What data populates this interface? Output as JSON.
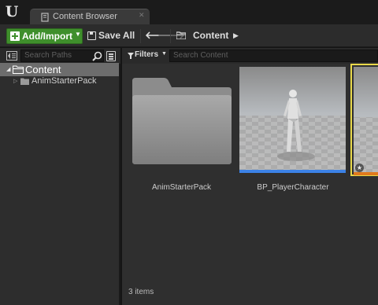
{
  "window": {
    "tab_title": "Content Browser",
    "logo_letter": "U"
  },
  "toolbar": {
    "add_import_label": "Add/Import",
    "save_all_label": "Save All",
    "breadcrumb": [
      "Content"
    ]
  },
  "sources_panel": {
    "search_placeholder": "Search Paths",
    "tree": [
      {
        "label": "Content",
        "expanded": true,
        "selected": true
      },
      {
        "label": "AnimStarterPack",
        "expanded": false,
        "selected": false
      }
    ]
  },
  "content_panel": {
    "filters_label": "Filters",
    "search_placeholder": "Search Content",
    "assets": [
      {
        "name": "AnimStarterPack",
        "type": "folder"
      },
      {
        "name": "BP_PlayerCharacter",
        "type": "blueprint",
        "accent": "#3c82e6"
      },
      {
        "name": "",
        "type": "asset",
        "selected": true,
        "accent": "#e07a1e"
      }
    ],
    "item_count": "3 items"
  },
  "colors": {
    "add_button": "#3f8f2c",
    "selection_outline": "#e8d84a",
    "blueprint_bar": "#3c82e6",
    "selected_asset_bar": "#e07a1e",
    "tree_selected": "#6d6d6d"
  },
  "icons": [
    "unreal-logo-icon",
    "content-browser-icon",
    "close-icon",
    "add-icon",
    "save-icon",
    "back-arrow-icon",
    "forward-arrow-icon",
    "folder-icon",
    "chevron-right-icon",
    "sources-toggle-icon",
    "search-icon",
    "view-options-icon",
    "filter-icon",
    "star-icon"
  ]
}
